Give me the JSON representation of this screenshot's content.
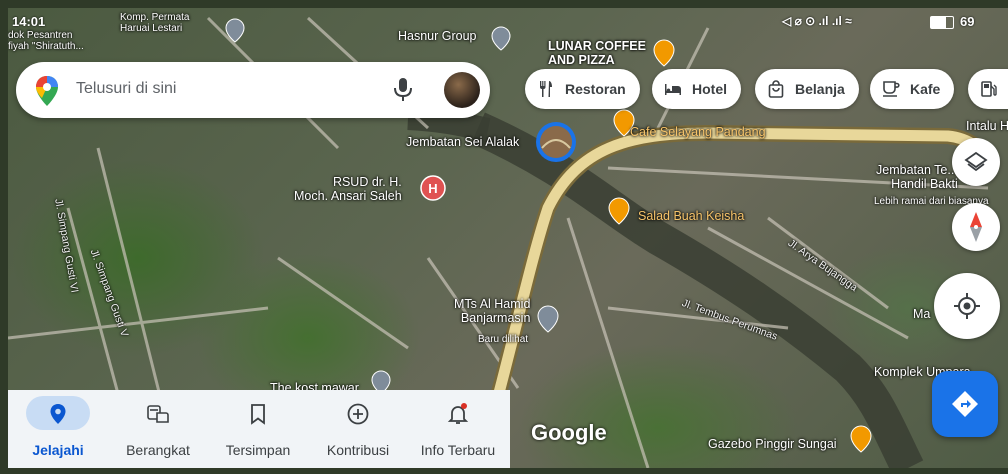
{
  "status_bar": {
    "time": "14:01",
    "battery": "69"
  },
  "search": {
    "placeholder": "Telusuri di sini"
  },
  "chips": [
    {
      "label": "Restoran",
      "icon": "restaurant-icon"
    },
    {
      "label": "Hotel",
      "icon": "hotel-icon"
    },
    {
      "label": "Belanja",
      "icon": "shopping-bag-icon"
    },
    {
      "label": "Kafe",
      "icon": "cafe-icon"
    }
  ],
  "map_labels": {
    "komp_permata": "Komp. Permata\nHaruai Lestari",
    "pesantren": "dok Pesantren\nfiyah \"Shiratuth...",
    "hasnur": "Hasnur Group",
    "lunar": "LUNAR COFFEE\nAND PIZZA",
    "jembatan_alalak": "Jembatan Sei Alalak",
    "cafe_selayang": "Cafe Selayang Pandang",
    "rsud": "RSUD dr. H.\nMoch. Ansari Saleh",
    "salad": "Salad Buah Keisha",
    "jembatan_handil": "Jembatan Te...\nHandil Bakti",
    "lebih_ramai": "Lebih ramai dari biasanya",
    "intalu": "Intalu H",
    "mts": "MTs Al Hamid\nBanjarmasin",
    "baru_dilihat": "Baru dilihat",
    "kost": "The kost mawar",
    "gazebo": "Gazebo Pinggir Sungai",
    "komplek": "Komplek Umpara...",
    "ma": "Ma",
    "jl_gusti_vi": "Jl. Simpang Gusti VI",
    "jl_gusti_v": "Jl. Simpang Gusti V",
    "jl_arya": "Jl. Arya Bujangga",
    "jl_tembus": "Jl. Tembus Perumnas"
  },
  "branding": "Google",
  "nav": [
    {
      "label": "Jelajahi",
      "active": true
    },
    {
      "label": "Berangkat",
      "active": false
    },
    {
      "label": "Tersimpan",
      "active": false
    },
    {
      "label": "Kontribusi",
      "active": false
    },
    {
      "label": "Info Terbaru",
      "active": false
    }
  ],
  "colors": {
    "accent": "#1a73e8",
    "active_nav": "#0b57d0",
    "food_pin": "#f29900",
    "hospital_pin": "#e05252",
    "road_primary": "#e8d79a"
  }
}
